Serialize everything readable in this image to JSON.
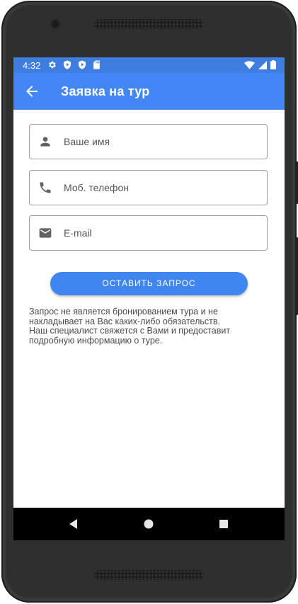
{
  "status_bar": {
    "time": "4:32",
    "left_icons": [
      "settings-icon",
      "play-protect-icon",
      "play-protect-icon",
      "sd-card-icon"
    ],
    "right_icons": [
      "wifi-icon",
      "signal-icon",
      "battery-icon"
    ]
  },
  "app_bar": {
    "title": "Заявка на тур",
    "back_icon": "arrow-back-icon",
    "color": "#4287f5"
  },
  "form": {
    "name_field": {
      "placeholder": "Ваше имя",
      "value": "",
      "icon": "person-icon"
    },
    "phone_field": {
      "placeholder": "Моб. телефон",
      "value": "",
      "icon": "phone-icon"
    },
    "email_field": {
      "placeholder": "E-mail",
      "value": "",
      "icon": "email-icon"
    },
    "submit_label": "ОСТАВИТЬ ЗАПРОС"
  },
  "disclaimer": {
    "lines": [
      "Запрос не является бронированием тура и не",
      "накладывает на Вас каких-либо обязательств.",
      "Наш специалист свяжется с Вами и предоставит",
      "подробную информацию о туре."
    ]
  },
  "nav_bar": {
    "buttons": [
      "back-triangle-icon",
      "home-circle-icon",
      "recents-square-icon"
    ]
  }
}
